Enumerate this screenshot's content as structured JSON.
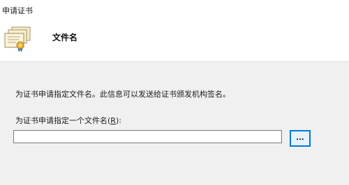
{
  "window": {
    "title": "申请证书"
  },
  "header": {
    "title": "文件名",
    "icon": "certificate-icon"
  },
  "main": {
    "description": "为证书申请指定文件名。此信息可以发送给证书颁发机构签名。",
    "field_label_prefix": "为证书申请指定一个文件名(",
    "field_label_mnemonic": "R",
    "field_label_suffix": "):",
    "file_input_value": "",
    "browse_label": "..."
  },
  "colors": {
    "panel_background": "#f0f0f0",
    "button_border": "#0078d7",
    "button_fill": "#e5f1fb"
  }
}
